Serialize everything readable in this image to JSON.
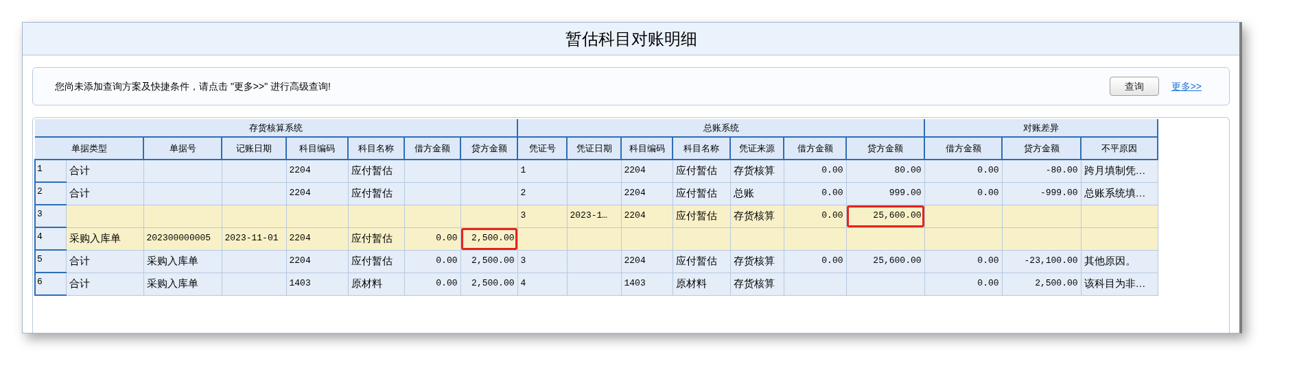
{
  "window": {
    "title": "暂估科目对账明细"
  },
  "query_bar": {
    "notice": "您尚未添加查询方案及快捷条件，请点击 \"更多>>\" 进行高级查询!",
    "button": "查询",
    "link": "更多>>"
  },
  "table": {
    "groups": [
      "存货核算系统",
      "总账系统",
      "对账差异"
    ],
    "columns": [
      "单据类型",
      "单据号",
      "记账日期",
      "科目编码",
      "科目名称",
      "借方金额",
      "贷方金额",
      "凭证号",
      "凭证日期",
      "科目编码",
      "科目名称",
      "凭证来源",
      "借方金额",
      "贷方金额",
      "借方金额",
      "贷方金额",
      "不平原因"
    ],
    "rows": [
      {
        "number": "1",
        "highlighted": false,
        "cells": [
          "合计",
          null,
          null,
          "2204",
          "应付暂估",
          null,
          null,
          "1",
          null,
          "2204",
          "应付暂估",
          "存货核算",
          "0.00",
          "80.00",
          "0.00",
          "-80.00",
          "跨月填制凭…"
        ]
      },
      {
        "number": "2",
        "highlighted": false,
        "cells": [
          "合计",
          null,
          null,
          "2204",
          "应付暂估",
          null,
          null,
          "2",
          null,
          "2204",
          "应付暂估",
          "总账",
          "0.00",
          "999.00",
          "0.00",
          "-999.00",
          "总账系统填…"
        ]
      },
      {
        "number": "3",
        "highlighted": true,
        "cells": [
          null,
          null,
          null,
          null,
          null,
          null,
          null,
          "3",
          "2023-1…",
          "2204",
          "应付暂估",
          "存货核算",
          "0.00",
          {
            "text": "25,600.00",
            "boxed": true
          },
          null,
          null,
          null
        ]
      },
      {
        "number": "4",
        "highlighted": true,
        "cells": [
          "采购入库单",
          "202300000005",
          "2023-11-01",
          "2204",
          "应付暂估",
          "0.00",
          {
            "text": "2,500.00",
            "boxed": true
          },
          null,
          null,
          null,
          null,
          null,
          null,
          null,
          null,
          null,
          null
        ]
      },
      {
        "number": "5",
        "highlighted": false,
        "cells": [
          "合计",
          "采购入库单",
          null,
          "2204",
          "应付暂估",
          "0.00",
          "2,500.00",
          "3",
          null,
          "2204",
          "应付暂估",
          "存货核算",
          "0.00",
          "25,600.00",
          "0.00",
          "-23,100.00",
          "其他原因。"
        ]
      },
      {
        "number": "6",
        "highlighted": false,
        "cells": [
          "合计",
          "采购入库单",
          null,
          "1403",
          "原材料",
          "0.00",
          "2,500.00",
          "4",
          null,
          "1403",
          "原材料",
          "存货核算",
          null,
          null,
          "0.00",
          "2,500.00",
          "该科目为非…"
        ]
      }
    ]
  }
}
